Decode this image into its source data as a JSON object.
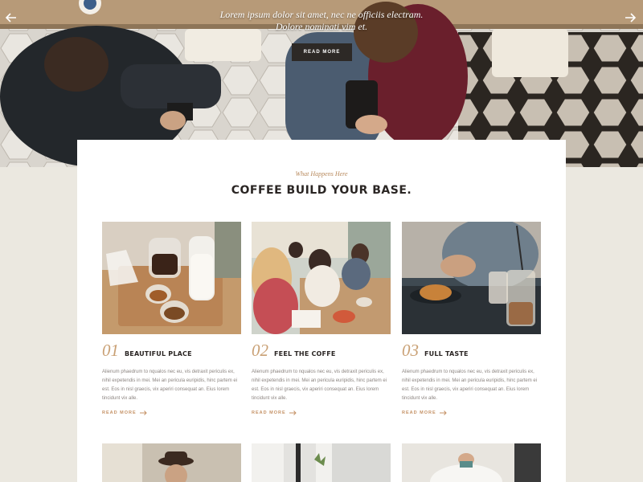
{
  "hero": {
    "line1": "Lorem ipsum dolor sit amet, nec ne officiis electram.",
    "line2": "Dolore nominati vim et.",
    "button_label": "READ MORE"
  },
  "section": {
    "eyebrow": "What Happens Here",
    "heading": "COFFEE BUILD YOUR BASE."
  },
  "features": [
    {
      "number": "01",
      "title": "BEAUTIFUL PLACE",
      "body": "Alienum phaedrum to nqualos nec eu, vis detraxit periculis ex, nihil expetendis in mei. Mei an pericula euripidis, hinc partem ei est. Eos in nisl graecis, vix aperiri consequat an. Eius lorem tincidunt vix alle.",
      "link": "READ MORE"
    },
    {
      "number": "02",
      "title": "FEEL THE COFFE",
      "body": "Alienum phaedrum to nqualos nec eu, vis detraxit periculis ex, nihil expetendis in mei. Mei an pericula euripidis, hinc partem ei est. Eos in nisl graecis, vix aperiri consequat an. Eius lorem tincidunt vix alle.",
      "link": "READ MORE"
    },
    {
      "number": "03",
      "title": "FULL TASTE",
      "body": "Alienum phaedrum to nqualos nec eu, vis detraxit periculis ex, nihil expetendis in mei. Mei an pericula euripidis, hinc partem ei est. Eos in nisl graecis, vix aperiri consequat an. Eius lorem tincidunt vix alle.",
      "link": "READ MORE"
    }
  ],
  "colors": {
    "accent": "#c59266",
    "dark": "#2d2926",
    "page_bg": "#ebe8e0"
  }
}
